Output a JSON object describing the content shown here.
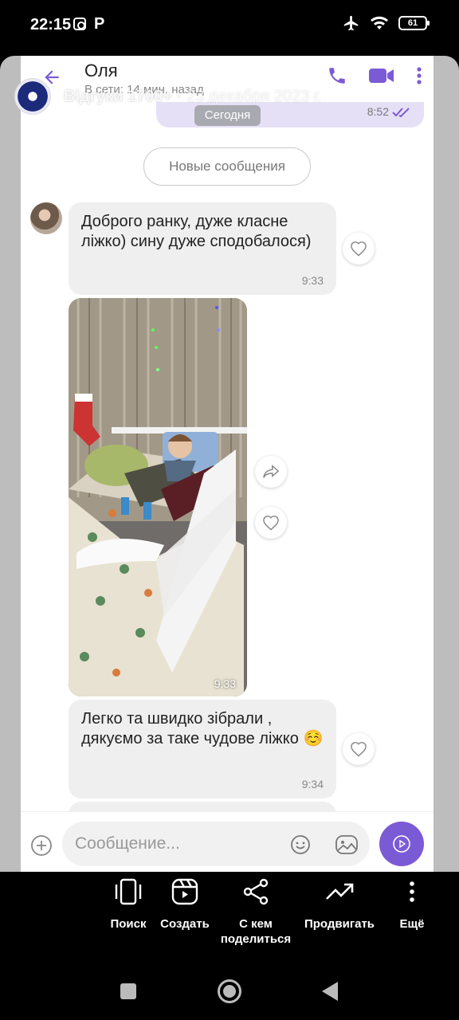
{
  "status_bar": {
    "time": "22:15",
    "battery": "61"
  },
  "header": {
    "contact_name": "Оля",
    "contact_status": "В сети: 14 мин. назад"
  },
  "overlay": {
    "text": "Відгуки 1700+",
    "date": "23 декабря 2023 г."
  },
  "previous_message": {
    "time": "8:52"
  },
  "date_chip": "Сегодня",
  "new_messages_label": "Новые сообщения",
  "messages": [
    {
      "text": "Доброго ранку, дуже класне ліжко) сину дуже сподобалося)",
      "time": "9:33"
    },
    {
      "type": "photo",
      "time": "9:33"
    },
    {
      "text": "Легко та швидко зібрали , дякуємо за таке чудове ліжко ☺️",
      "time": "9:34"
    }
  ],
  "input": {
    "placeholder": "Сообщение..."
  },
  "bottom_actions": [
    {
      "label": "Поиск",
      "icon": "phone-frame-icon"
    },
    {
      "label": "Создать",
      "icon": "reels-icon"
    },
    {
      "label": "С кем поделиться",
      "icon": "share-icon"
    },
    {
      "label": "Продвигать",
      "icon": "trending-up-icon"
    },
    {
      "label": "Ещё",
      "icon": "more-vertical-icon"
    }
  ],
  "colors": {
    "accent": "#7b5ad6",
    "bubble": "#efefef",
    "outgoing_bubble": "#e6e0f7"
  }
}
